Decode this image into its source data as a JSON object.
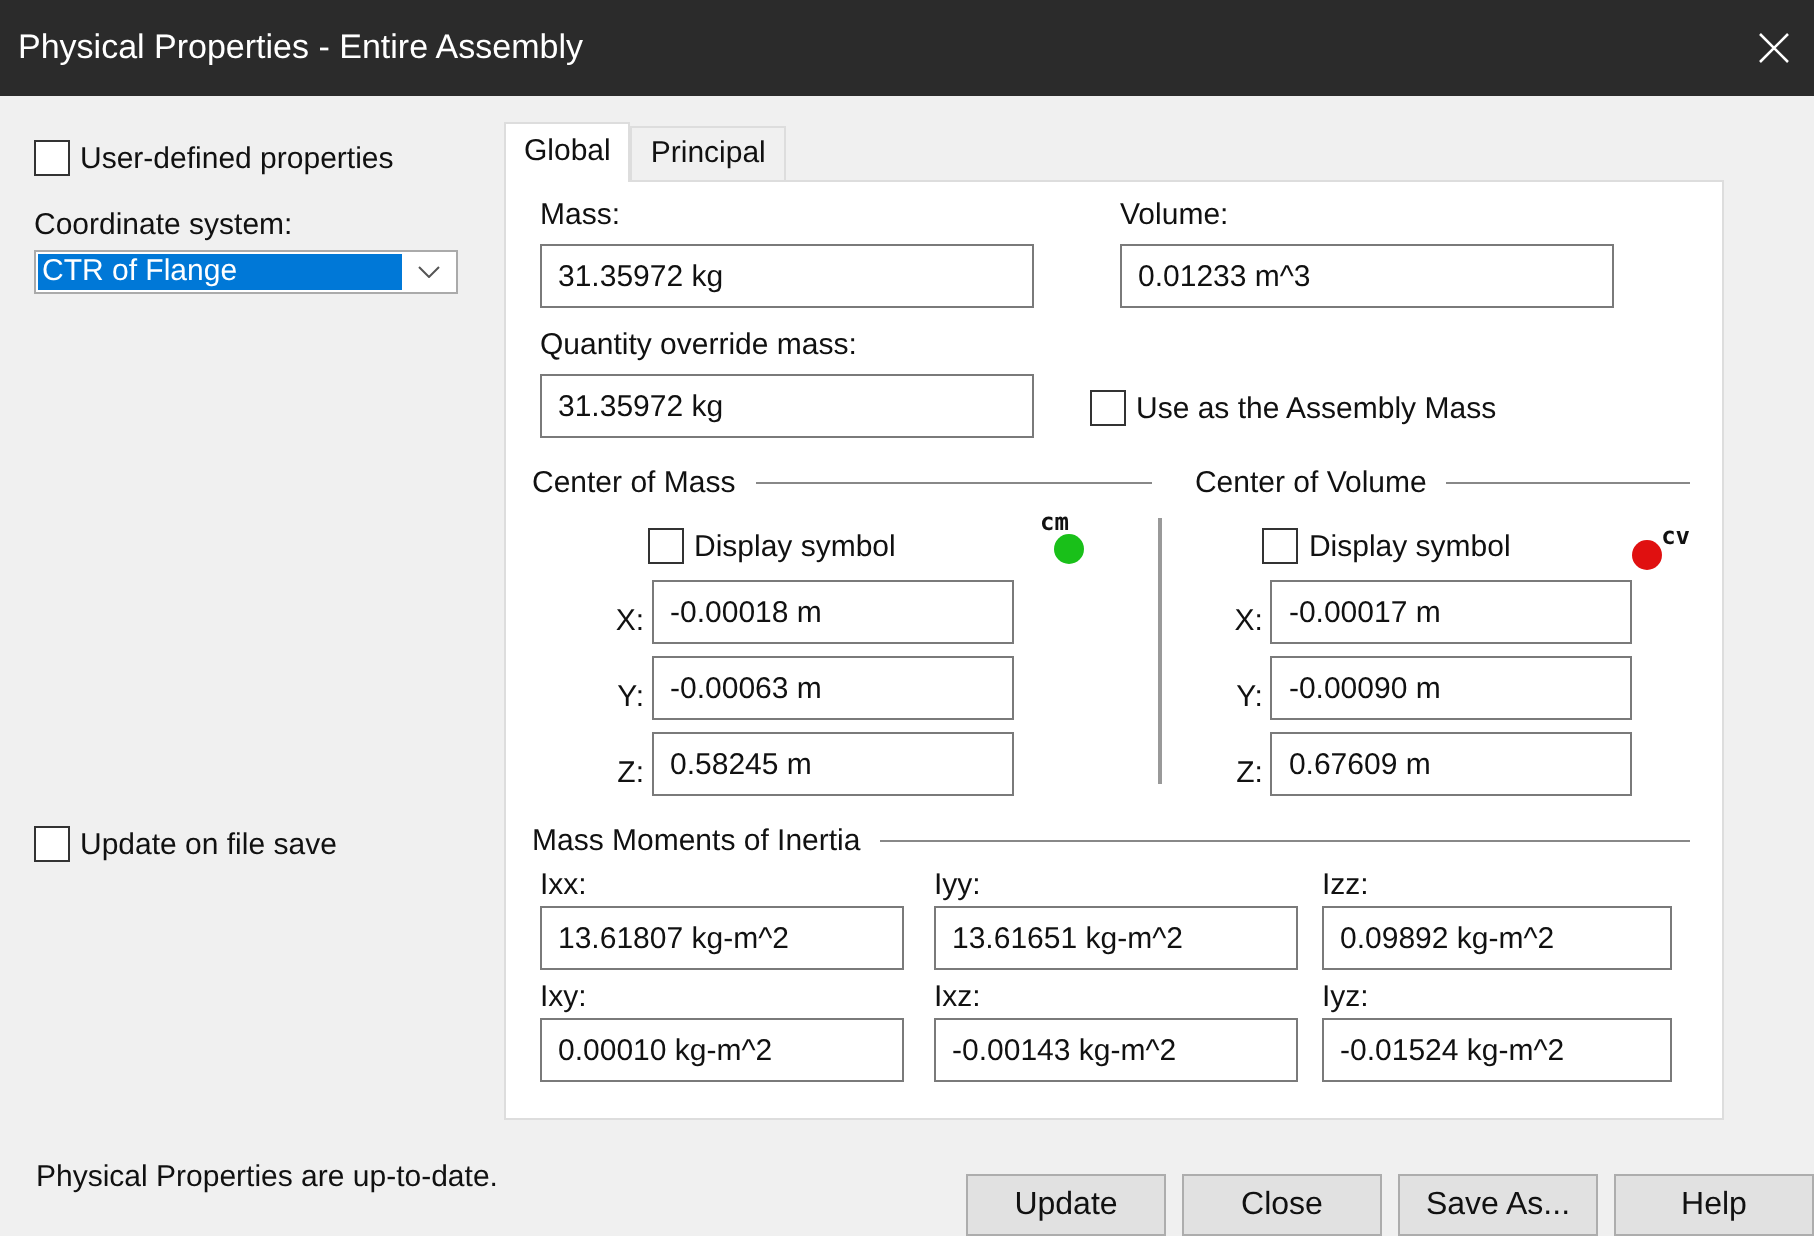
{
  "window": {
    "title": "Physical Properties - Entire Assembly"
  },
  "left": {
    "user_defined": {
      "label": "User-defined properties",
      "checked": false
    },
    "coordinate_system": {
      "label": "Coordinate system:",
      "value": "CTR of Flange"
    },
    "update_on_save": {
      "label": "Update on file save",
      "checked": false
    }
  },
  "tabs": [
    {
      "label": "Global",
      "selected": true
    },
    {
      "label": "Principal",
      "selected": false
    }
  ],
  "mass": {
    "label": "Mass:",
    "value": "31.35972 kg"
  },
  "volume": {
    "label": "Volume:",
    "value": "0.01233 m^3"
  },
  "quantity_override": {
    "label": "Quantity override mass:",
    "value": "31.35972 kg"
  },
  "use_as_assembly_mass": {
    "label": "Use as the Assembly Mass",
    "checked": false
  },
  "centers": [
    {
      "title": "Center of Mass",
      "display_symbol": {
        "label": "Display symbol",
        "checked": false
      },
      "symbol": {
        "label": "cm",
        "color": "#19c019",
        "kind": "above"
      },
      "coords": [
        {
          "axis": "X:",
          "value": "-0.00018 m"
        },
        {
          "axis": "Y:",
          "value": "-0.00063 m"
        },
        {
          "axis": "Z:",
          "value": "0.58245 m"
        }
      ]
    },
    {
      "title": "Center of Volume",
      "display_symbol": {
        "label": "Display symbol",
        "checked": false
      },
      "symbol": {
        "label": "cv",
        "color": "#e01010",
        "kind": "after"
      },
      "coords": [
        {
          "axis": "X:",
          "value": "-0.00017 m"
        },
        {
          "axis": "Y:",
          "value": "-0.00090 m"
        },
        {
          "axis": "Z:",
          "value": "0.67609 m"
        }
      ]
    }
  ],
  "inertia": {
    "title": "Mass Moments of Inertia",
    "rows": [
      [
        {
          "label": "Ixx:",
          "value": "13.61807 kg-m^2"
        },
        {
          "label": "Iyy:",
          "value": "13.61651 kg-m^2"
        },
        {
          "label": "Izz:",
          "value": "0.09892 kg-m^2"
        }
      ],
      [
        {
          "label": "Ixy:",
          "value": "0.00010 kg-m^2"
        },
        {
          "label": "Ixz:",
          "value": "-0.00143 kg-m^2"
        },
        {
          "label": "Iyz:",
          "value": "-0.01524 kg-m^2"
        }
      ]
    ]
  },
  "status": "Physical Properties are up-to-date.",
  "buttons": [
    "Update",
    "Close",
    "Save As...",
    "Help"
  ]
}
